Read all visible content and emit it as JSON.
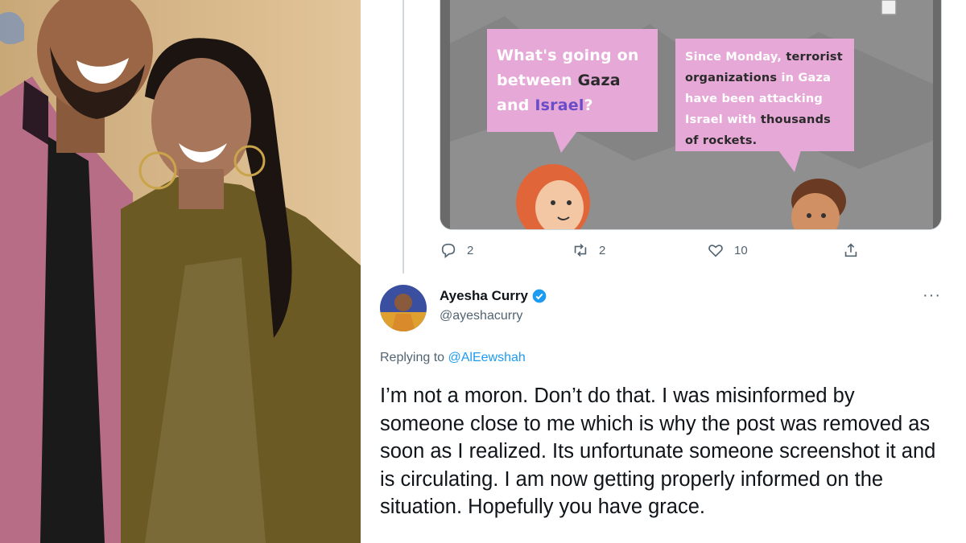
{
  "thread_tweet": {
    "media": {
      "bubble_left": {
        "parts": [
          {
            "text": "What's going on between ",
            "style": "plain"
          },
          {
            "text": "Gaza",
            "style": "highlight"
          },
          {
            "text": " and ",
            "style": "plain"
          },
          {
            "text": "Israel",
            "style": "purple"
          },
          {
            "text": "?",
            "style": "plain"
          }
        ]
      },
      "bubble_right": {
        "parts": [
          {
            "text": "Since Monday, ",
            "style": "plain"
          },
          {
            "text": "terrorist organizations",
            "style": "highlight"
          },
          {
            "text": " in Gaza have been attacking Israel with ",
            "style": "plain"
          },
          {
            "text": "thousands of rockets.",
            "style": "highlight"
          }
        ]
      }
    },
    "actions": {
      "reply_count": "2",
      "retweet_count": "2",
      "like_count": "10"
    }
  },
  "reply_tweet": {
    "display_name": "Ayesha Curry",
    "handle": "@ayeshacurry",
    "more_label": "···",
    "replying_prefix": "Replying to",
    "replying_mention": "@AlEewshah",
    "text": "I’m not a moron. Don’t do that. I was misinformed by someone close to me which is why the post was removed as soon as I realized. Its unfortunate someone screenshot it and is circulating. I am now getting properly informed on the situation. Hopefully you have grace."
  },
  "colors": {
    "link_blue": "#1d9bf0",
    "muted_gray": "#536471",
    "bubble_pink": "#e6a8d6"
  }
}
